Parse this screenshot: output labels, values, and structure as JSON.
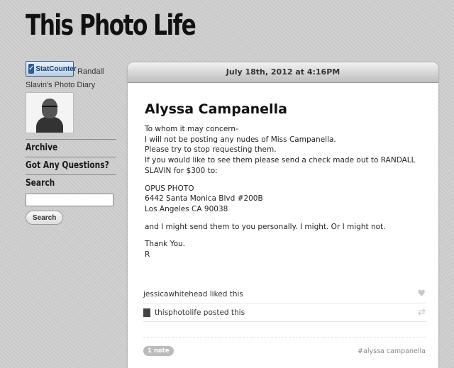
{
  "site": {
    "title": "This Photo Life"
  },
  "sidebar": {
    "statcounter_label": "StatCounter",
    "diary_title": "Randall Slavin's Photo Diary",
    "archive_label": "Archive",
    "questions_label": "Got Any Questions?",
    "search_heading": "Search",
    "search_button": "Search"
  },
  "post": {
    "date": "July 18th, 2012 at 4:16PM",
    "title": "Alyssa Campanella",
    "paragraph1_lines": [
      "To whom it may concern-",
      "I will not be posting any nudes of Miss Campanella.",
      "Please try to stop requesting them.",
      "If you would like to see them please send a check made out to RANDALL SLAVIN for $300 to:"
    ],
    "address_lines": [
      "OPUS PHOTO",
      "6442 Santa Monica Blvd #200B",
      "Los Angeles CA 90038"
    ],
    "paragraph3": "and I might send them to you personally. I might. Or I might not.",
    "signoff_lines": [
      "Thank You.",
      "R"
    ],
    "notes": [
      {
        "text": "jessicawhitehead liked this",
        "icon": "heart-icon"
      },
      {
        "text": "thisphotolife posted this",
        "icon": "reblog-icon"
      }
    ],
    "note_count": "1 note",
    "tag": "#alyssa campanella"
  }
}
